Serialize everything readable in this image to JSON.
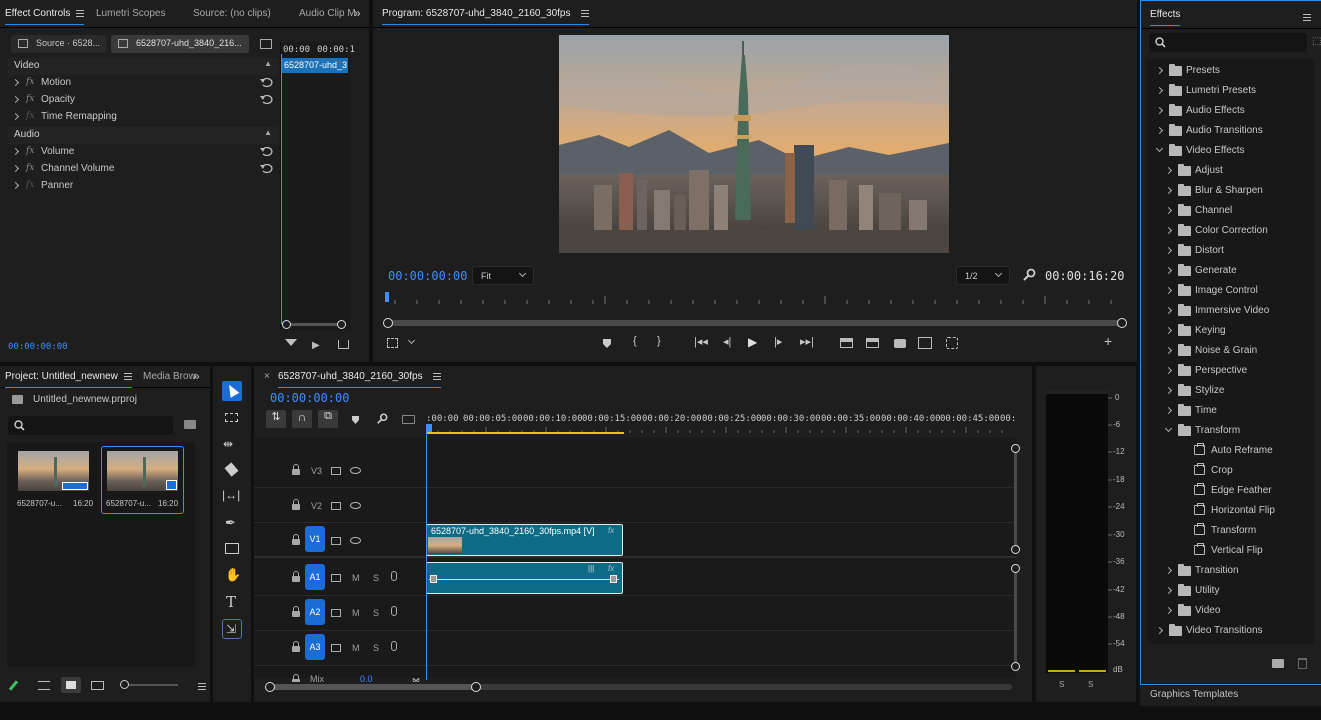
{
  "effect_controls": {
    "tabs": [
      "Effect Controls",
      "Lumetri Scopes",
      "Source: (no clips)",
      "Audio Clip M"
    ],
    "source_chip": "Source · 6528...",
    "clip_chip": "6528707-uhd_3840_216...",
    "mini_ruler": [
      "00:00",
      "00:00:1"
    ],
    "mini_clip": "6528707-uhd_3",
    "video_section": "Video",
    "audio_section": "Audio",
    "video_effects": [
      "Motion",
      "Opacity",
      "Time Remapping"
    ],
    "audio_effects": [
      "Volume",
      "Channel Volume",
      "Panner"
    ],
    "fx_glyph": "fx",
    "timecode": "00:00:00:00"
  },
  "program": {
    "title": "Program: 6528707-uhd_3840_2160_30fps",
    "timecode_left": "00:00:00:00",
    "fit_select": "Fit",
    "resolution_select": "1/2",
    "timecode_right": "00:00:16:20",
    "image_subject": "Taipei city skyline at sunset"
  },
  "effects": {
    "tab": "Effects",
    "search_placeholder": "",
    "top_folders": [
      "Presets",
      "Lumetri Presets",
      "Audio Effects",
      "Audio Transitions",
      "Video Effects"
    ],
    "video_effects_folders": [
      "Adjust",
      "Blur & Sharpen",
      "Channel",
      "Color Correction",
      "Distort",
      "Generate",
      "Image Control",
      "Immersive Video",
      "Keying",
      "Noise & Grain",
      "Perspective",
      "Stylize",
      "Time",
      "Transform"
    ],
    "transform_items": [
      "Auto Reframe",
      "Crop",
      "Edge Feather",
      "Horizontal Flip",
      "Transform",
      "Vertical Flip"
    ],
    "after_folders": [
      "Transition",
      "Utility",
      "Video"
    ],
    "last_folder": "Video Transitions",
    "graphics_templates": "Graphics Templates"
  },
  "project": {
    "tabs": [
      "Project: Untitled_newnew",
      "Media Brow"
    ],
    "file": "Untitled_newnew.prproj",
    "items": [
      {
        "name": "6528707-u...",
        "duration": "16:20"
      },
      {
        "name": "6528707-u...",
        "duration": "16:20"
      }
    ]
  },
  "timeline": {
    "tab": "6528707-uhd_3840_2160_30fps",
    "close": "×",
    "timecode": "00:00:00:00",
    "ruler": [
      ":00:00",
      "00:00:05:00",
      "00:00:10:00",
      "00:00:15:00",
      "00:00:20:00",
      "00:00:25:00",
      "00:00:30:00",
      "00:00:35:00",
      "00:00:40:00",
      "00:00:45:00",
      "00:0"
    ],
    "video_tracks": [
      "V3",
      "V2",
      "V1"
    ],
    "audio_tracks": [
      "A1",
      "A2",
      "A3"
    ],
    "mix_label": "Mix",
    "mix_value": "0.0",
    "m_label": "M",
    "s_label": "S",
    "video_clip": "6528707-uhd_3840_2160_30fps.mp4 [V]",
    "fx_badge": "fx"
  },
  "audio_meter": {
    "scale": [
      "0",
      "-6",
      "-12",
      "-18",
      "-24",
      "-30",
      "-36",
      "-42",
      "-48",
      "-54",
      "dB"
    ],
    "solo": [
      "S",
      "S"
    ]
  },
  "colors": {
    "accent": "#2d8ceb",
    "track_badge": "#1c6cd6",
    "clip": "#0e6b86",
    "playhead": "#3e8eff",
    "work_area": "#e6c419"
  }
}
